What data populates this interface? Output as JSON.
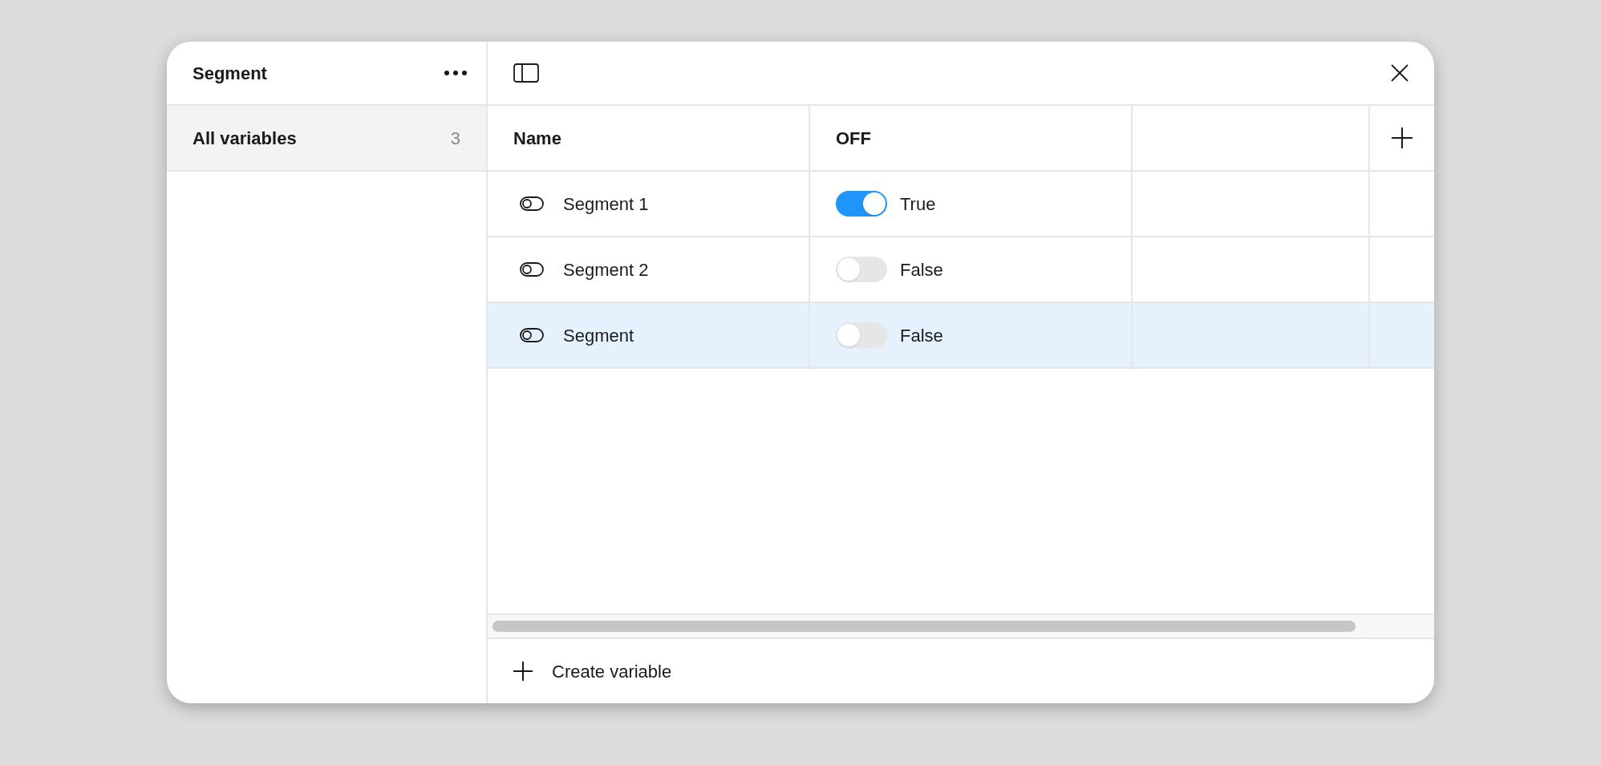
{
  "sidebar": {
    "title": "Segment",
    "items": [
      {
        "label": "All variables",
        "count": "3",
        "selected": true
      }
    ]
  },
  "table": {
    "columns": [
      "Name",
      "OFF"
    ],
    "rows": [
      {
        "name": "Segment 1",
        "on": true,
        "value": "True",
        "selected": false
      },
      {
        "name": "Segment 2",
        "on": false,
        "value": "False",
        "selected": false
      },
      {
        "name": "Segment",
        "on": false,
        "value": "False",
        "selected": true
      }
    ]
  },
  "footer": {
    "button": "Create variable"
  }
}
